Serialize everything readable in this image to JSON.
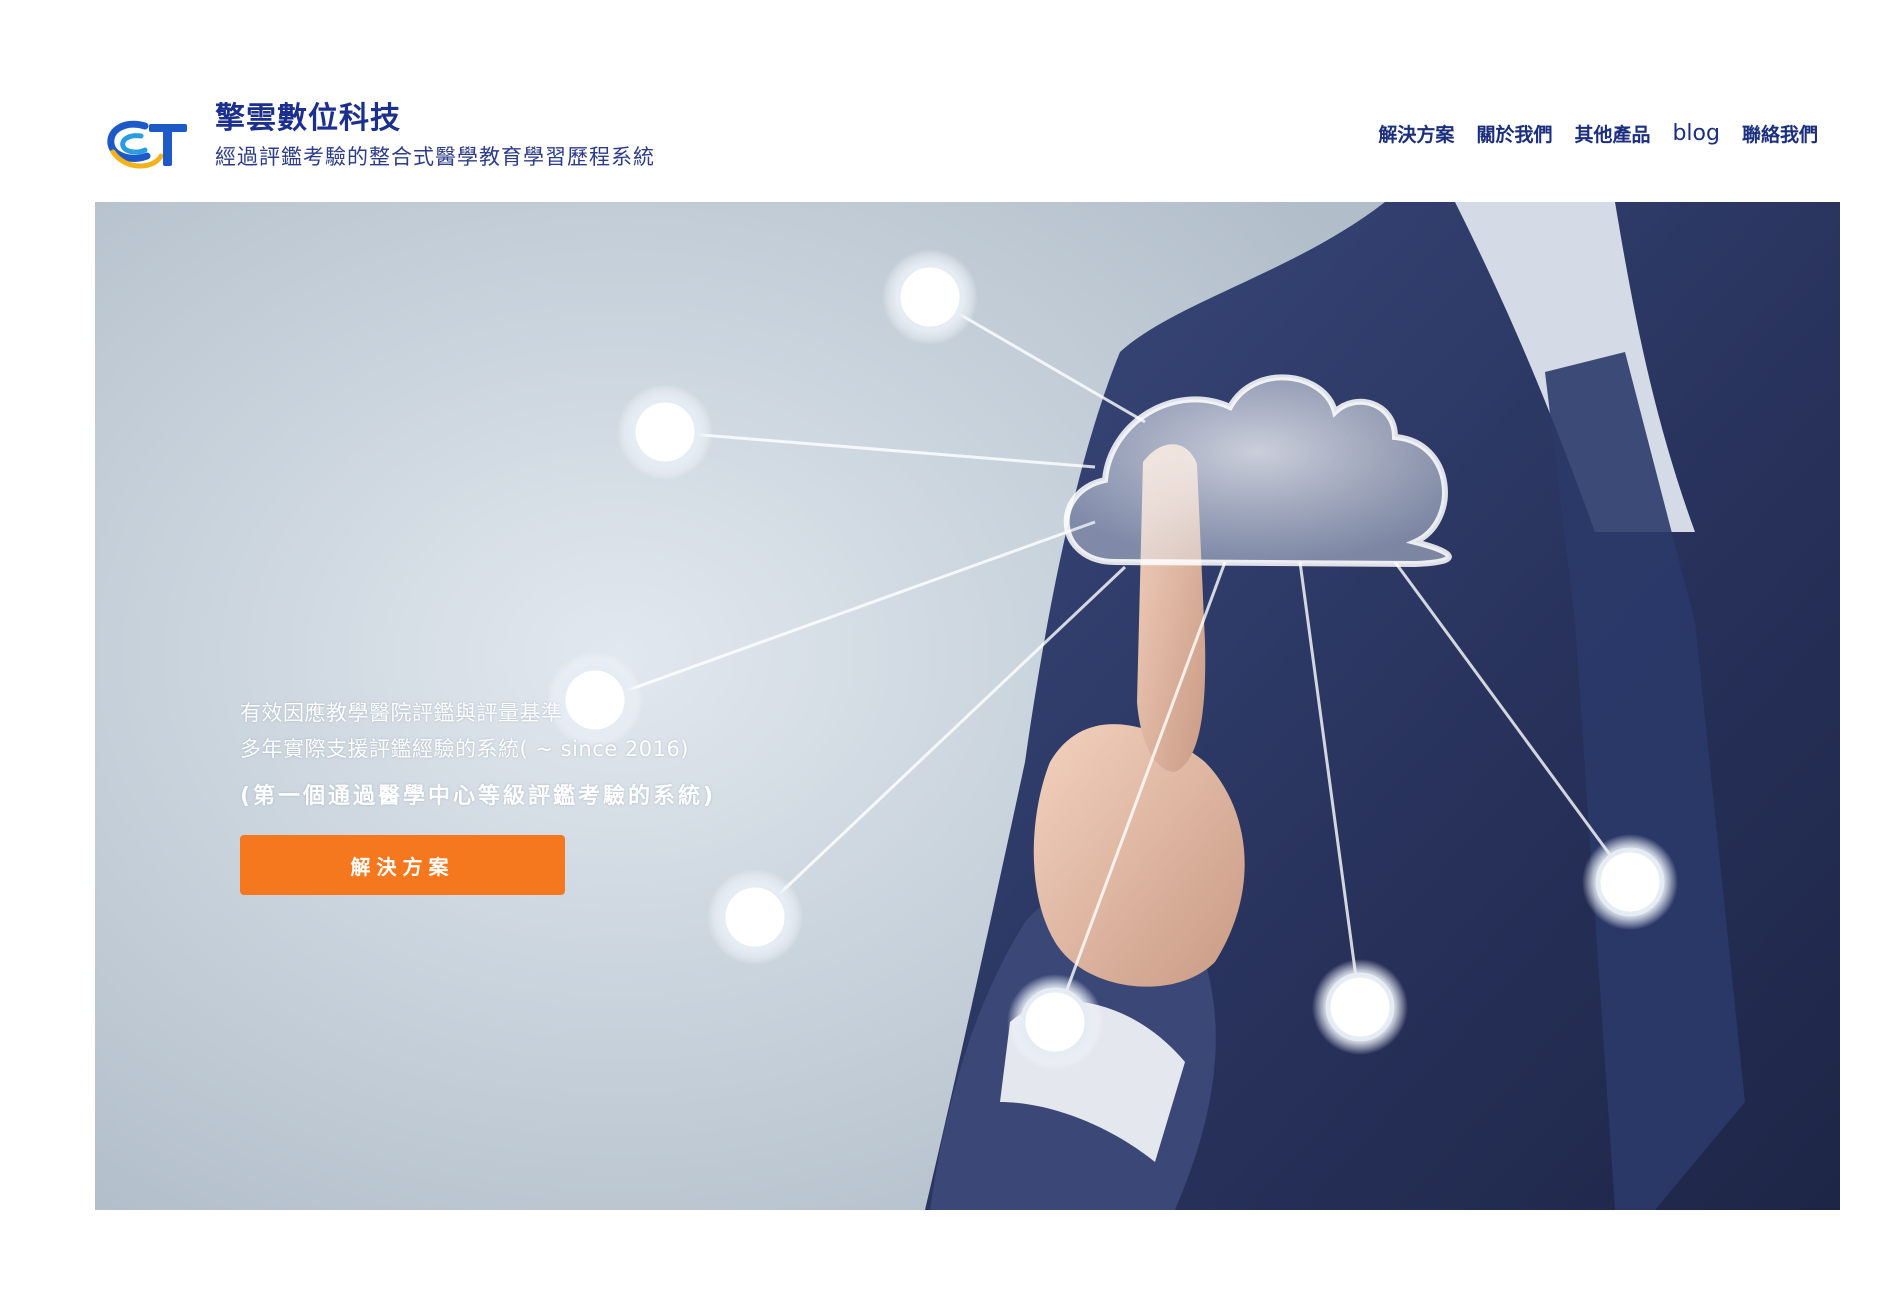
{
  "brand": {
    "title": "擎雲數位科技",
    "subtitle": "經過評鑑考驗的整合式醫學教育學習歷程系統",
    "logo_icon": "ct-logo-icon"
  },
  "nav": {
    "items": [
      {
        "label": "解決方案"
      },
      {
        "label": "關於我們"
      },
      {
        "label": "其他產品"
      },
      {
        "label": "blog"
      },
      {
        "label": "聯絡我們"
      }
    ]
  },
  "hero": {
    "line1": "有效因應教學醫院評鑑與評量基準",
    "line2": "多年實際支援評鑑經驗的系統( ~ since 2016)",
    "highlight": "(第一個通過醫學中心等級評鑑考驗的系統)",
    "cta_label": "解決方案",
    "image_subject": "cloud-network-icon"
  },
  "colors": {
    "brand_blue": "#1b2f8e",
    "cta_orange": "#f5781f",
    "hero_bg": "#c6d0da",
    "suit_navy": "#2a3560"
  }
}
